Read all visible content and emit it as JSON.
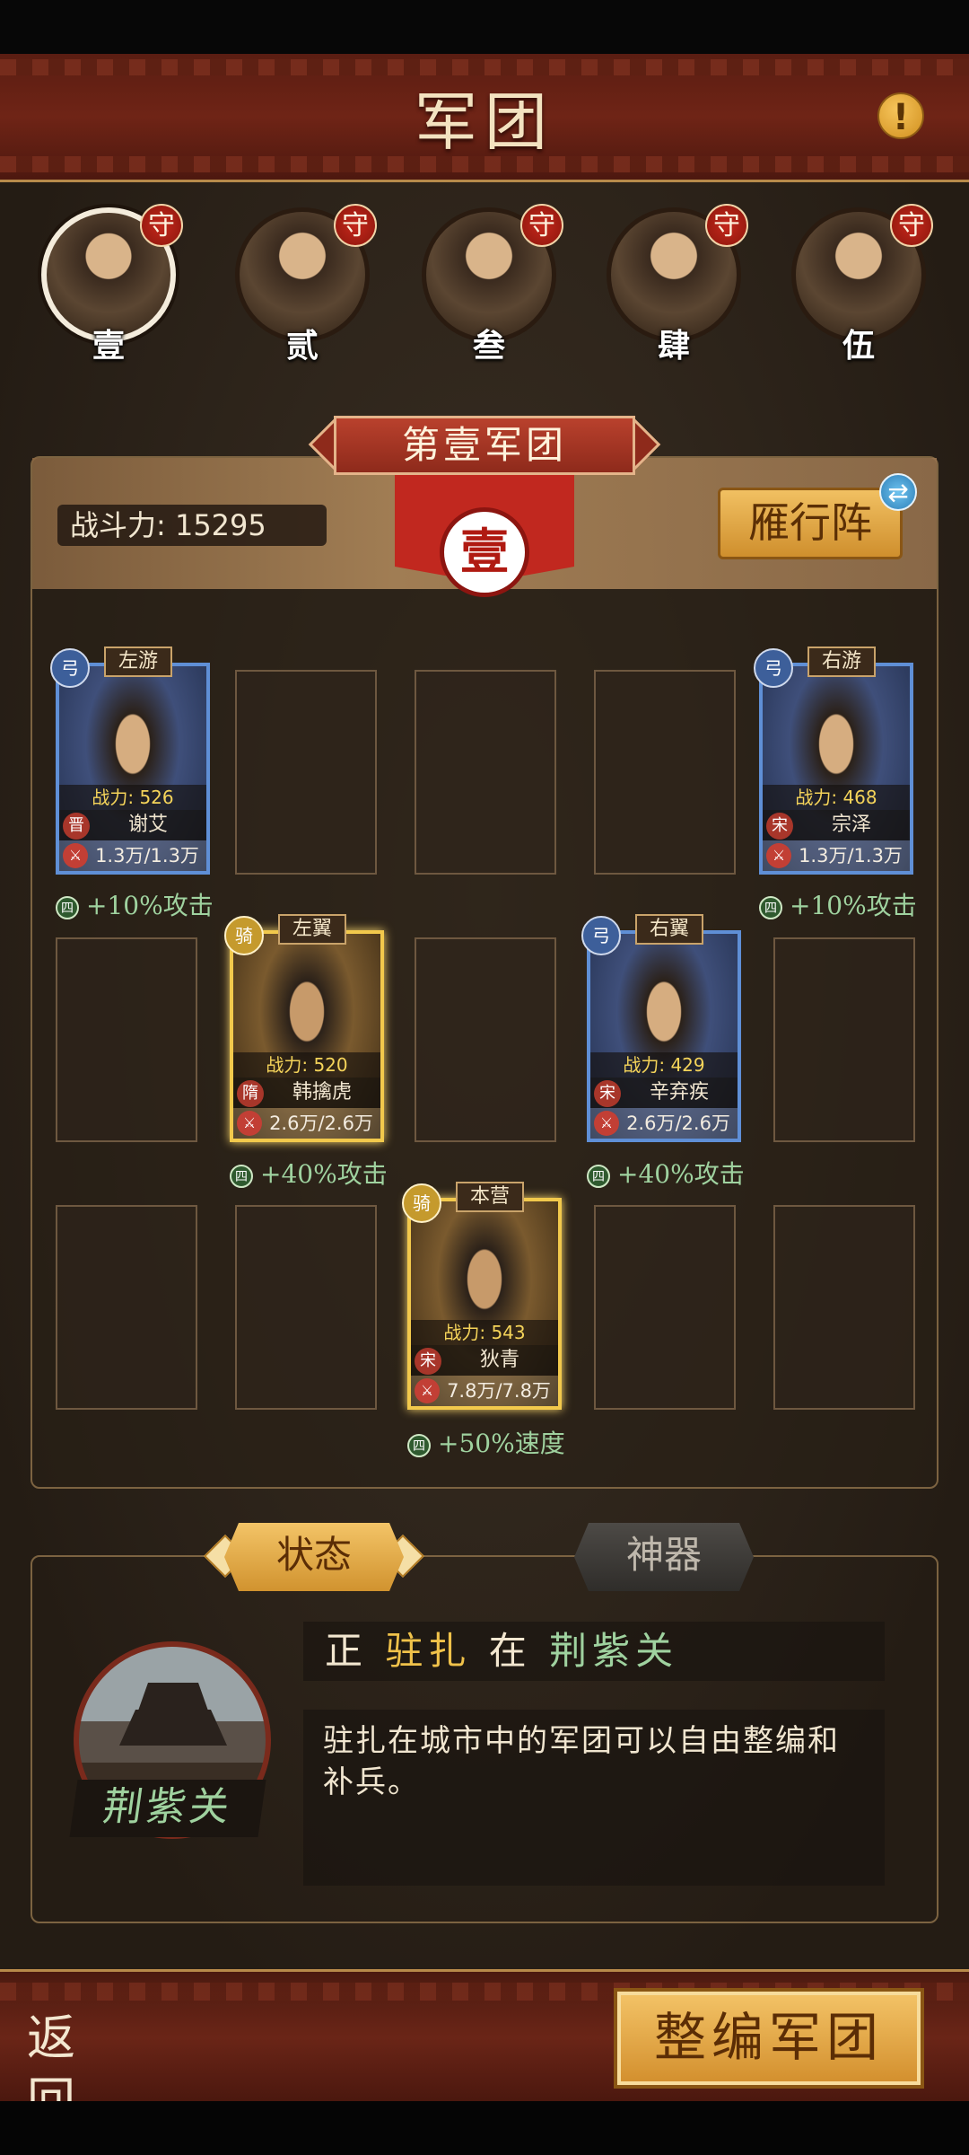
{
  "header": {
    "title": "军团",
    "info_icon": "!"
  },
  "legions": [
    {
      "role_badge": "守",
      "number": "壹",
      "selected": true
    },
    {
      "role_badge": "守",
      "number": "贰",
      "selected": false
    },
    {
      "role_badge": "守",
      "number": "叁",
      "selected": false
    },
    {
      "role_badge": "守",
      "number": "肆",
      "selected": false
    },
    {
      "role_badge": "守",
      "number": "伍",
      "selected": false
    }
  ],
  "legion": {
    "banner_title": "第壹军团",
    "emblem": "壹",
    "combat_power": "战斗力: 15295",
    "formation": "雁行阵"
  },
  "generals": [
    {
      "position": "左游",
      "type_icon": "弓",
      "power": "战力: 526",
      "nation": "晋",
      "name": "谢艾",
      "troops": "1.3万/1.3万",
      "bonus_icon": "四",
      "bonus": "+10%攻击"
    },
    {
      "position": "右游",
      "type_icon": "弓",
      "power": "战力: 468",
      "nation": "宋",
      "name": "宗泽",
      "troops": "1.3万/1.3万",
      "bonus_icon": "四",
      "bonus": "+10%攻击"
    },
    {
      "position": "左翼",
      "type_icon": "骑",
      "power": "战力: 520",
      "nation": "隋",
      "name": "韩擒虎",
      "troops": "2.6万/2.6万",
      "bonus_icon": "四",
      "bonus": "+40%攻击"
    },
    {
      "position": "右翼",
      "type_icon": "弓",
      "power": "战力: 429",
      "nation": "宋",
      "name": "辛弃疾",
      "troops": "2.6万/2.6万",
      "bonus_icon": "四",
      "bonus": "+40%攻击"
    },
    {
      "position": "本营",
      "type_icon": "骑",
      "power": "战力: 543",
      "nation": "宋",
      "name": "狄青",
      "troops": "7.8万/7.8万",
      "bonus_icon": "四",
      "bonus": "+50%速度"
    }
  ],
  "tabs": {
    "status": "状态",
    "artifact": "神器"
  },
  "status": {
    "word1": "正",
    "word2": "驻扎",
    "word3": "在",
    "city": "荆紫关",
    "description": "驻扎在城市中的军团可以自由整编和补兵。"
  },
  "footer": {
    "back": "返 回",
    "reorganize": "整编军团"
  },
  "colors": {
    "gold": "#f2c94c",
    "blue_frame": "#5f8fd6",
    "green_text": "#9fd29f",
    "red_banner": "#c1281f"
  }
}
